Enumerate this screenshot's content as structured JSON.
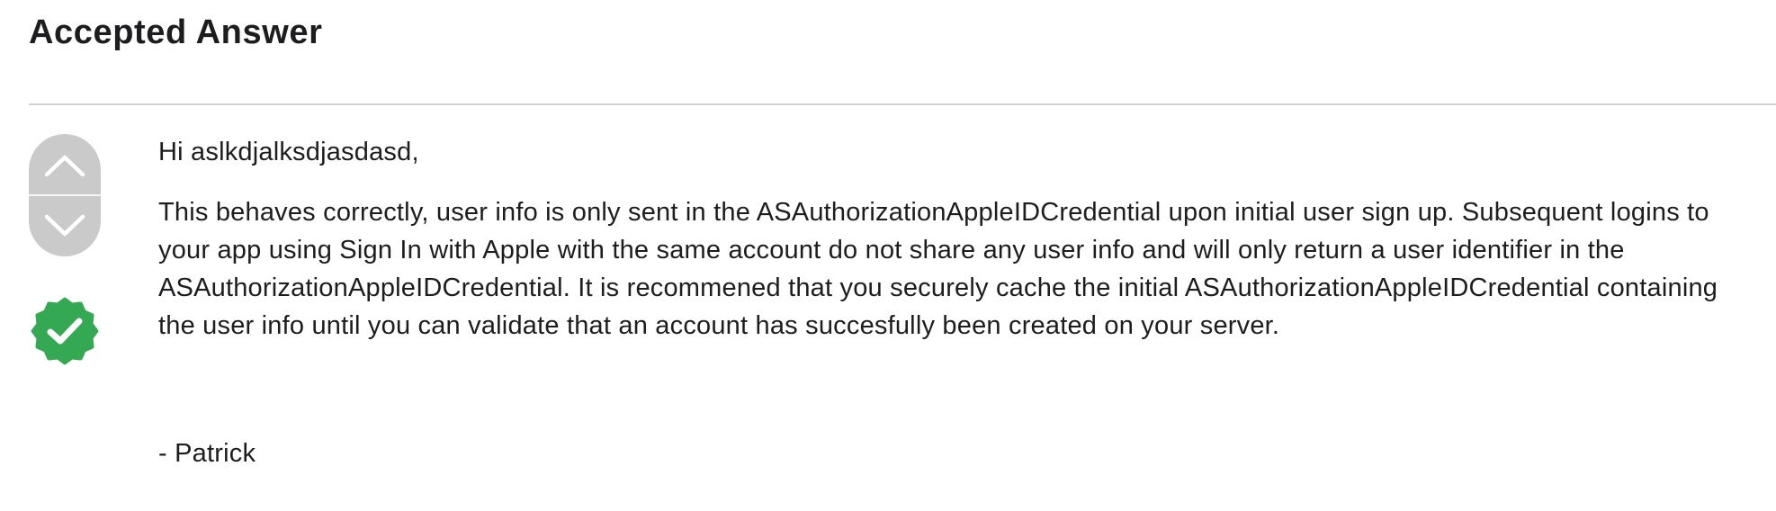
{
  "section": {
    "heading": "Accepted Answer"
  },
  "votes": {
    "upvote_icon": "chevron-up-icon",
    "downvote_icon": "chevron-down-icon",
    "accepted_icon": "checkmark-seal-icon"
  },
  "answer": {
    "greeting": "Hi aslkdjalksdjasdasd,",
    "body": "This behaves correctly, user info is only sent in the ASAuthorizationAppleIDCredential upon initial user sign up. Subsequent logins to your app using Sign In with Apple with the same account do not share any user info and will only return a user identifier in the ASAuthorizationAppleIDCredential. It is recommened that you securely cache the initial ASAuthorizationAppleIDCredential containing the user info until you can validate that an account has succesfully been created on your server.",
    "signature": "- Patrick"
  },
  "colors": {
    "vote_pill": "#cacaca",
    "vote_icon": "#ffffff",
    "accepted_badge": "#34a853",
    "divider": "#d2d2d7",
    "text": "#1d1d1f"
  }
}
